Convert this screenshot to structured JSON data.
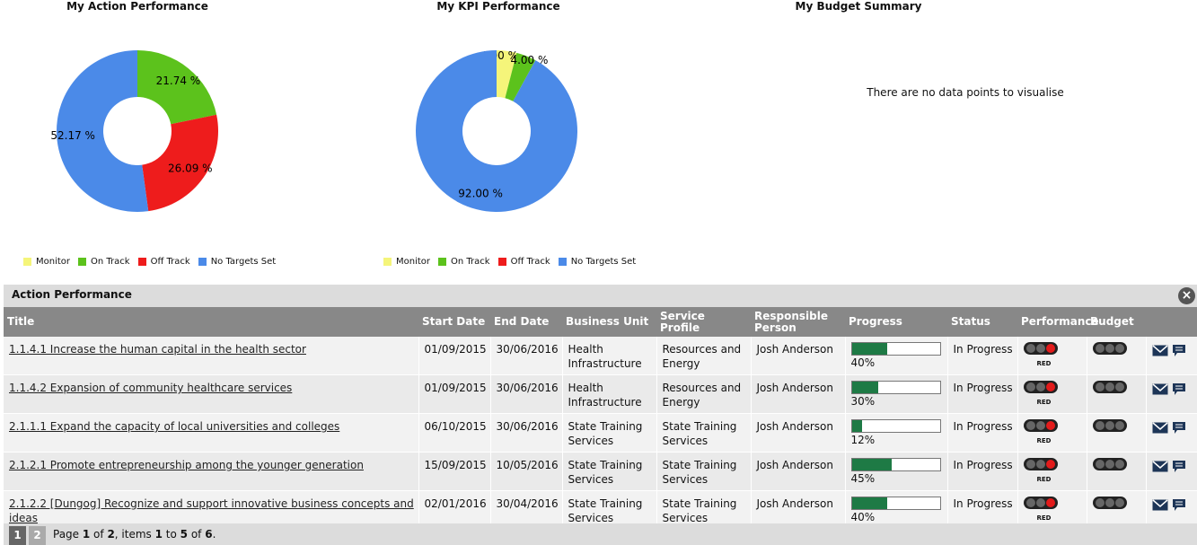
{
  "charts": {
    "action": {
      "title": "My Action Performance"
    },
    "kpi": {
      "title": "My KPI Performance"
    },
    "budget": {
      "title": "My Budget Summary",
      "empty_message": "There are no data points to visualise"
    }
  },
  "chart_data": [
    {
      "type": "pie",
      "title": "My Action Performance",
      "categories": [
        "Monitor",
        "On Track",
        "Off Track",
        "No Targets Set"
      ],
      "values": [
        0,
        21.74,
        26.09,
        52.17
      ],
      "colors": [
        "#f5f57a",
        "#5cc21c",
        "#ee1c1c",
        "#4b8ae8"
      ],
      "labels": [
        "",
        "21.74 %",
        "26.09 %",
        "52.17 %"
      ],
      "legend": "bottom"
    },
    {
      "type": "pie",
      "title": "My KPI Performance",
      "categories": [
        "Monitor",
        "On Track",
        "Off Track",
        "No Targets Set"
      ],
      "values": [
        4.0,
        4.0,
        0,
        92.0
      ],
      "colors": [
        "#f5f57a",
        "#5cc21c",
        "#ee1c1c",
        "#4b8ae8"
      ],
      "labels": [
        "4.00 %",
        "4.00 %",
        "",
        "92.00 %"
      ],
      "legend": "bottom"
    }
  ],
  "legend": [
    {
      "label": "Monitor",
      "color": "#f5f57a"
    },
    {
      "label": "On Track",
      "color": "#5cc21c"
    },
    {
      "label": "Off Track",
      "color": "#ee1c1c"
    },
    {
      "label": "No Targets Set",
      "color": "#4b8ae8"
    }
  ],
  "panel": {
    "title": "Action Performance",
    "close_icon": "close-icon",
    "columns": [
      "Title",
      "Start Date",
      "End Date",
      "Business Unit",
      "Service Profile",
      "Responsible Person",
      "Progress",
      "Status",
      "Performance",
      "Budget",
      ""
    ],
    "rows": [
      {
        "title": "1.1.4.1 Increase the human capital in the health sector",
        "start": "01/09/2015",
        "end": "30/06/2016",
        "unit": "Health Infrastructure",
        "profile": "Resources and Energy",
        "person": "Josh Anderson",
        "progress": 40,
        "progress_label": "40%",
        "status": "In Progress",
        "perf_label": "RED"
      },
      {
        "title": "1.1.4.2 Expansion of community healthcare services",
        "start": "01/09/2015",
        "end": "30/06/2016",
        "unit": "Health Infrastructure",
        "profile": "Resources and Energy",
        "person": "Josh Anderson",
        "progress": 30,
        "progress_label": "30%",
        "status": "In Progress",
        "perf_label": "RED"
      },
      {
        "title": "2.1.1.1 Expand the capacity of local universities and colleges",
        "start": "06/10/2015",
        "end": "30/06/2016",
        "unit": "State Training Services",
        "profile": "State Training Services",
        "person": "Josh Anderson",
        "progress": 12,
        "progress_label": "12%",
        "status": "In Progress",
        "perf_label": "RED"
      },
      {
        "title": "2.1.2.1 Promote entrepreneurship among the younger generation",
        "start": "15/09/2015",
        "end": "10/05/2016",
        "unit": "State Training Services",
        "profile": "State Training Services",
        "person": "Josh Anderson",
        "progress": 45,
        "progress_label": "45%",
        "status": "In Progress",
        "perf_label": "RED"
      },
      {
        "title": "2.1.2.2 [Dungog] Recognize and support innovative business concepts and ideas",
        "start": "02/01/2016",
        "end": "30/04/2016",
        "unit": "State Training Services",
        "profile": "State Training Services",
        "person": "Josh Anderson",
        "progress": 40,
        "progress_label": "40%",
        "status": "In Progress",
        "perf_label": "RED"
      }
    ],
    "pager": {
      "pages": [
        "1",
        "2"
      ],
      "text_page": "Page ",
      "current": "1",
      "text_of": " of ",
      "total_pages": "2",
      "text_items": ", items ",
      "from": "1",
      "text_to": " to ",
      "to": "5",
      "text_of2": " of ",
      "total_items": "6",
      "text_end": "."
    }
  }
}
